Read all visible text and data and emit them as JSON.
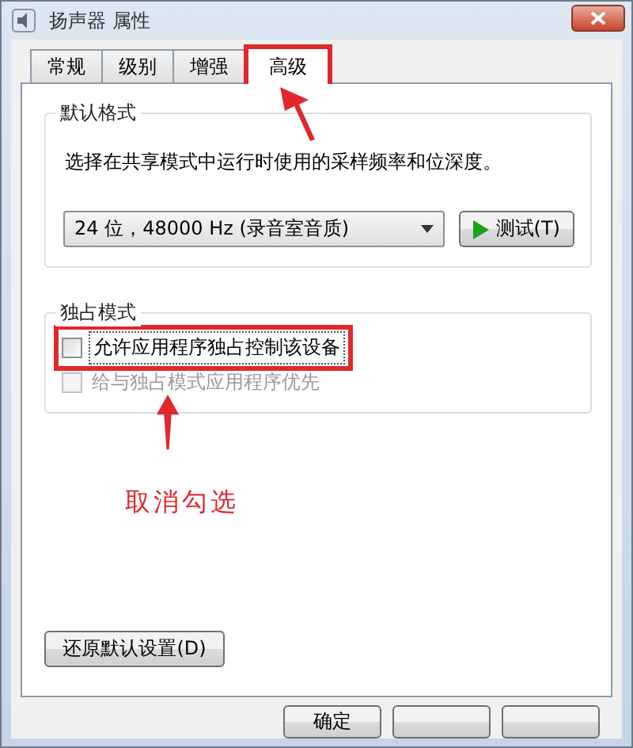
{
  "window": {
    "title": "扬声器 属性"
  },
  "tabs": [
    {
      "label": "常规",
      "selected": false,
      "highlighted": false
    },
    {
      "label": "级别",
      "selected": false,
      "highlighted": false
    },
    {
      "label": "增强",
      "selected": false,
      "highlighted": false
    },
    {
      "label": "高级",
      "selected": true,
      "highlighted": true
    }
  ],
  "default_format": {
    "title": "默认格式",
    "description": "选择在共享模式中运行时使用的采样频率和位深度。",
    "format_dropdown": {
      "value": "24 位，48000 Hz (录音室音质)"
    },
    "test_button": "测试(T)"
  },
  "exclusive_mode": {
    "title": "独占模式",
    "options": [
      {
        "label": "允许应用程序独占控制该设备",
        "checked": false,
        "disabled": false,
        "highlighted": true
      },
      {
        "label": "给与独占模式应用程序优先",
        "checked": false,
        "disabled": true,
        "highlighted": false
      }
    ]
  },
  "restore_button": "还原默认设置(D)",
  "buttons": [
    "确定"
  ],
  "annotation": {
    "text": "取消勾选"
  }
}
